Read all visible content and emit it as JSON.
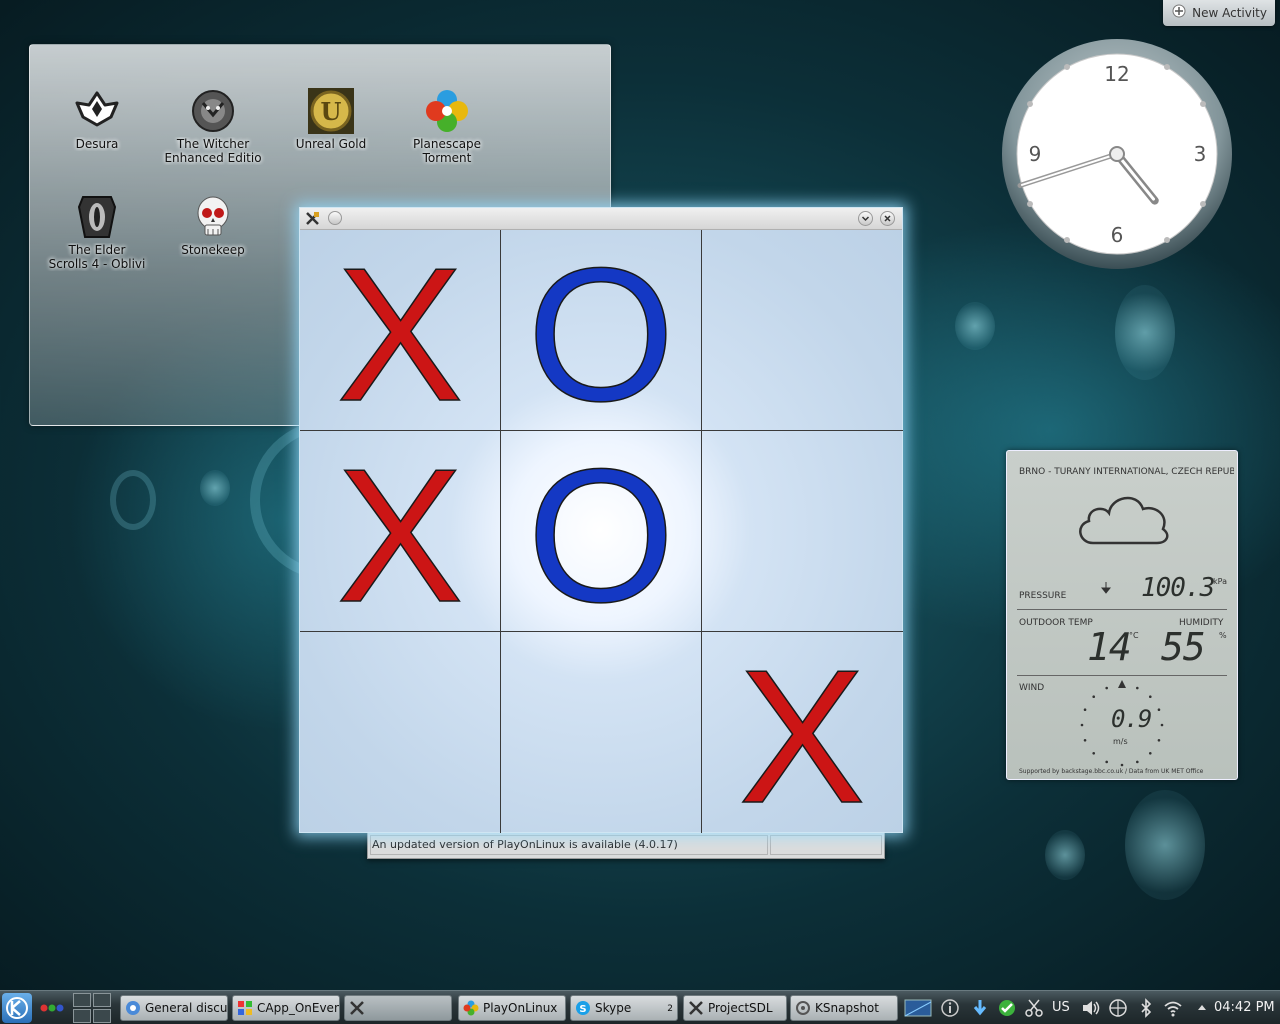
{
  "desktop": {
    "new_activity_label": "New Activity"
  },
  "folder_view": {
    "icons": [
      {
        "label": "Desura"
      },
      {
        "label": "The Witcher\nEnhanced Editio"
      },
      {
        "label": "Unreal Gold"
      },
      {
        "label": "Planescape\nTorment"
      },
      {
        "label": "The Elder\nScrolls 4 - Oblivi"
      },
      {
        "label": "Stonekeep"
      }
    ]
  },
  "clock": {
    "numerals": [
      "12",
      "3",
      "6",
      "9"
    ],
    "time_hour": 4,
    "time_minute": 42
  },
  "weather": {
    "station": "BRNO - TURANY INTERNATIONAL, CZECH REPUB",
    "pressure_label": "PRESSURE",
    "pressure_value": "100.3",
    "pressure_unit": "kPa",
    "outdoor_temp_label": "OUTDOOR TEMP",
    "outdoor_temp_value": "14",
    "temp_unit": "°C",
    "humidity_label": "HUMIDITY",
    "humidity_value": "55",
    "humidity_unit": "%",
    "wind_label": "WIND",
    "wind_value": "0.9",
    "wind_unit": "m/s",
    "credits": "Supported by backstage.bbc.co.uk / Data from UK MET Office"
  },
  "playonlinux": {
    "status_message": "An updated version of PlayOnLinux is available (4.0.17)"
  },
  "tictactoe": {
    "board": [
      "X",
      "O",
      "",
      "X",
      "O",
      "",
      "",
      "",
      "X"
    ],
    "colors": {
      "x": "#cc1515",
      "o": "#1438c4"
    }
  },
  "taskbar": {
    "tasks": [
      {
        "label": "General discu",
        "icon": "chrome-icon"
      },
      {
        "label": "CApp_OnEven",
        "icon": "windows-app-icon"
      },
      {
        "label": "",
        "icon": "tictactoe-icon"
      },
      {
        "label": "PlayOnLinux",
        "icon": "playonlinux-icon"
      },
      {
        "label": "Skype",
        "icon": "skype-icon",
        "count": "2"
      },
      {
        "label": "ProjectSDL",
        "icon": "tictactoe-icon"
      },
      {
        "label": "KSnapshot",
        "icon": "ksnapshot-icon"
      }
    ],
    "keyboard_layout": "US",
    "clock": "04:42 PM"
  }
}
